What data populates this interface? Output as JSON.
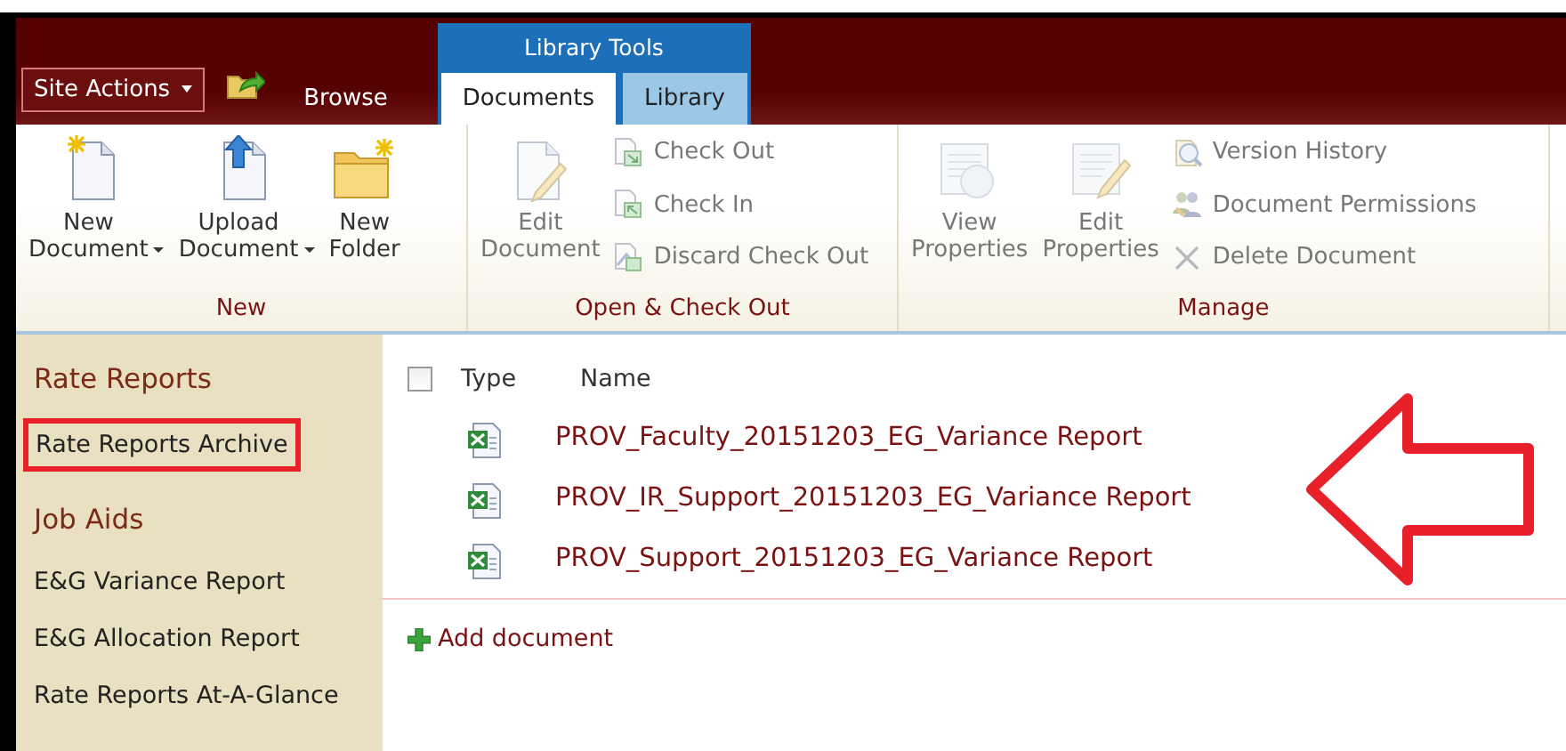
{
  "top_bar": {
    "site_actions": "Site Actions",
    "tab_group": "Library Tools",
    "tabs": [
      {
        "label": "Browse",
        "contextual": false,
        "selected": false
      },
      {
        "label": "Documents",
        "contextual": true,
        "selected": true
      },
      {
        "label": "Library",
        "contextual": true,
        "selected": false
      }
    ]
  },
  "ribbon": {
    "groups": [
      {
        "label": "New",
        "large": [
          {
            "label": "New Document",
            "kind": "new-doc",
            "dropdown": true,
            "disabled": false
          },
          {
            "label": "Upload Document",
            "kind": "upload",
            "dropdown": true,
            "disabled": false
          },
          {
            "label": "New Folder",
            "kind": "folder",
            "dropdown": false,
            "disabled": false
          }
        ]
      },
      {
        "label": "Open & Check Out",
        "large": [
          {
            "label": "Edit Document",
            "kind": "edit-doc",
            "dropdown": false,
            "disabled": true
          }
        ],
        "small": [
          {
            "label": "Check Out",
            "kind": "check-out",
            "disabled": true
          },
          {
            "label": "Check In",
            "kind": "check-in",
            "disabled": true
          },
          {
            "label": "Discard Check Out",
            "kind": "discard",
            "disabled": true
          }
        ]
      },
      {
        "label": "Manage",
        "large": [
          {
            "label": "View Properties",
            "kind": "view-props",
            "dropdown": false,
            "disabled": true
          },
          {
            "label": "Edit Properties",
            "kind": "edit-props",
            "dropdown": false,
            "disabled": true
          }
        ],
        "small": [
          {
            "label": "Version History",
            "kind": "history",
            "disabled": true
          },
          {
            "label": "Document Permissions",
            "kind": "permissions",
            "disabled": true
          },
          {
            "label": "Delete Document",
            "kind": "delete",
            "disabled": true
          }
        ]
      }
    ]
  },
  "sidebar": {
    "items": [
      {
        "kind": "heading",
        "label": "Rate Reports",
        "annotated": false
      },
      {
        "kind": "link",
        "label": "Rate Reports Archive",
        "annotated": true
      },
      {
        "kind": "heading",
        "label": "Job Aids",
        "annotated": false
      },
      {
        "kind": "link",
        "label": "E&G Variance Report",
        "annotated": false
      },
      {
        "kind": "link",
        "label": "E&G Allocation Report",
        "annotated": false
      },
      {
        "kind": "link",
        "label": "Rate Reports At-A-Glance",
        "annotated": false
      }
    ]
  },
  "documents": {
    "select_all": {
      "checked": false
    },
    "columns": [
      "Type",
      "Name"
    ],
    "rows": [
      {
        "kind": "excel",
        "name": "PROV_Faculty_20151203_EG_Variance Report"
      },
      {
        "kind": "excel",
        "name": "PROV_IR_Support_20151203_EG_Variance Report"
      },
      {
        "kind": "excel",
        "name": "PROV_Support_20151203_EG_Variance Report"
      }
    ],
    "add_link": "Add document"
  },
  "annotation_arrow": {
    "kind": "left"
  }
}
